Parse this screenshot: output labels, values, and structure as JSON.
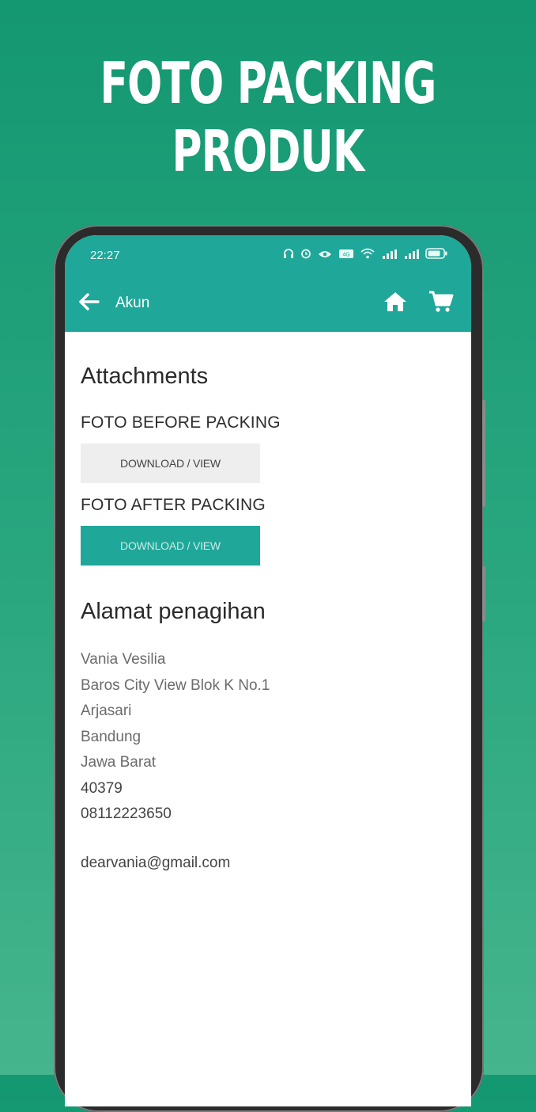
{
  "headline": {
    "line1": "FOTO PACKING",
    "line2": "PRODUK"
  },
  "status_bar": {
    "time": "22:27"
  },
  "app_bar": {
    "back_icon": "arrow-left-icon",
    "title": "Akun",
    "home_icon": "home-icon",
    "cart_icon": "cart-icon"
  },
  "attachments": {
    "heading": "Attachments",
    "before_label": "FOTO BEFORE PACKING",
    "before_button": "DOWNLOAD / VIEW",
    "after_label": "FOTO AFTER PACKING",
    "after_button": "DOWNLOAD / VIEW"
  },
  "billing": {
    "heading": "Alamat penagihan",
    "name": "Vania Vesilia",
    "street": "Baros City View Blok K No.1",
    "district": "Arjasari",
    "city": "Bandung",
    "province": "Jawa Barat",
    "postal_code": "40379",
    "phone": "08112223650",
    "email": "dearvania@gmail.com"
  },
  "colors": {
    "brand": "#1fa79a",
    "background": "#149872"
  }
}
